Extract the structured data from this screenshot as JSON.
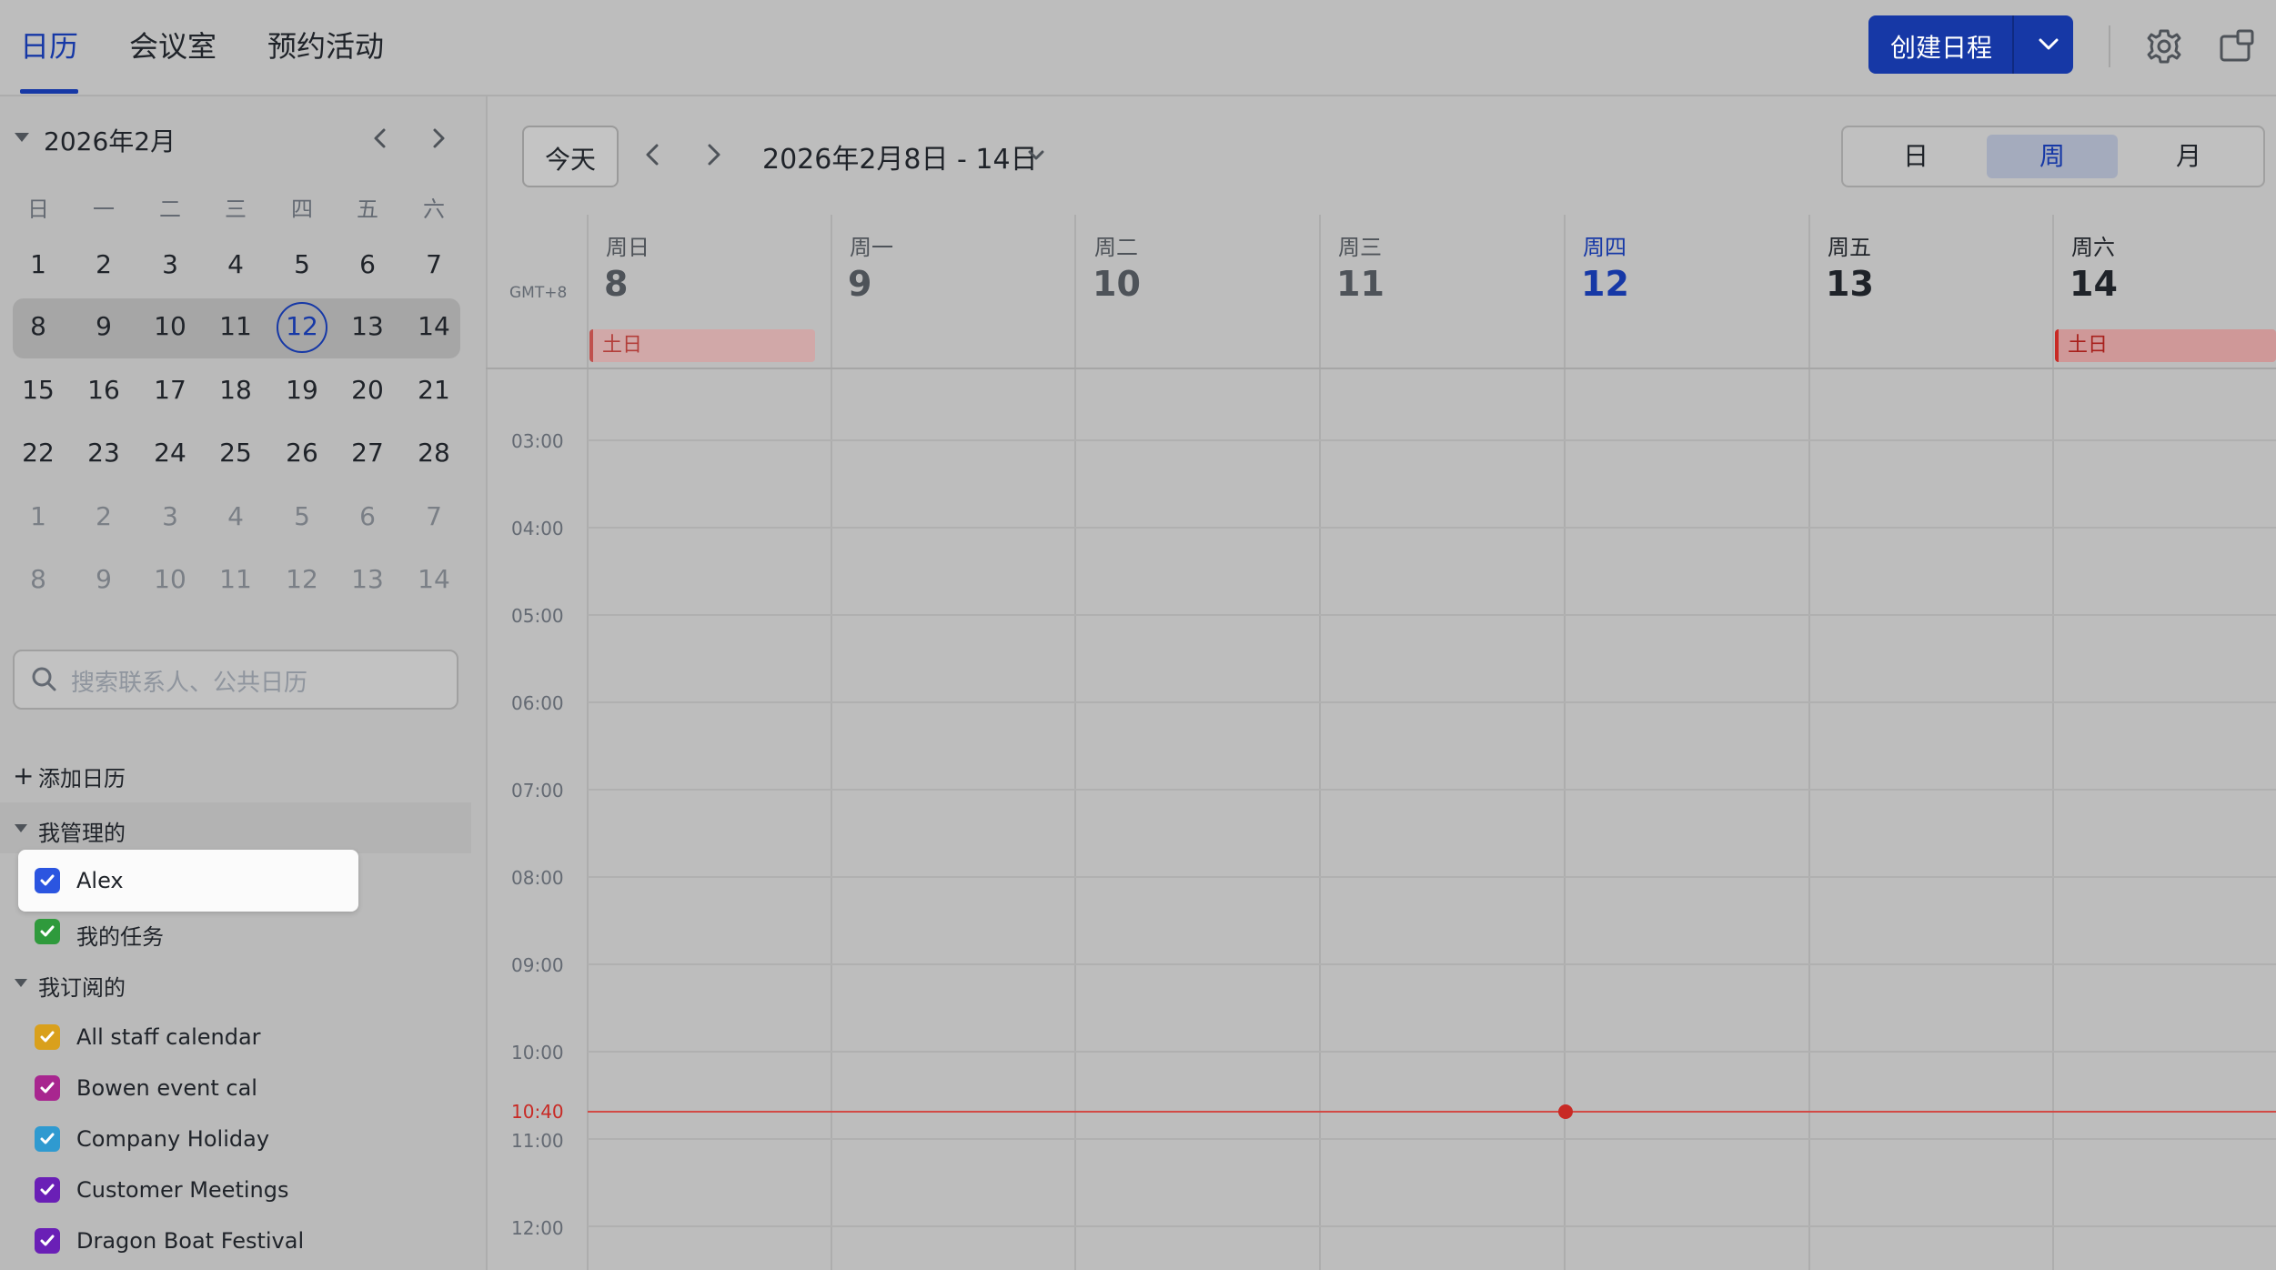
{
  "nav": {
    "tabs": [
      {
        "label": "日历",
        "active": true
      },
      {
        "label": "会议室"
      },
      {
        "label": "预约活动"
      }
    ],
    "create_label": "创建日程",
    "accent": "#1638a6"
  },
  "mini_calendar": {
    "month_label": "2026年2月",
    "weekdays": [
      "日",
      "一",
      "二",
      "三",
      "四",
      "五",
      "六"
    ],
    "weeks": [
      [
        "1",
        "2",
        "3",
        "4",
        "5",
        "6",
        "7"
      ],
      [
        "8",
        "9",
        "10",
        "11",
        "12",
        "13",
        "14"
      ],
      [
        "15",
        "16",
        "17",
        "18",
        "19",
        "20",
        "21"
      ],
      [
        "22",
        "23",
        "24",
        "25",
        "26",
        "27",
        "28"
      ],
      [
        "1",
        "2",
        "3",
        "4",
        "5",
        "6",
        "7"
      ],
      [
        "8",
        "9",
        "10",
        "11",
        "12",
        "13",
        "14"
      ]
    ],
    "today": "12"
  },
  "search": {
    "placeholder": "搜索联系人、公共日历"
  },
  "sidebar": {
    "add_calendar": "添加日历",
    "managed_title": "我管理的",
    "managed": [
      {
        "label": "Alex",
        "color": "#2b55e0"
      },
      {
        "label": "我的任务",
        "color": "#2f9a3c"
      }
    ],
    "subscribed_title": "我订阅的",
    "subscribed": [
      {
        "label": "All staff calendar",
        "color": "#d9a01c"
      },
      {
        "label": "Bowen event cal",
        "color": "#a8268f"
      },
      {
        "label": "Company Holiday",
        "color": "#2f9ad0"
      },
      {
        "label": "Customer Meetings",
        "color": "#6a1fb6"
      },
      {
        "label": "Dragon Boat Festival",
        "color": "#6a1fb6"
      }
    ]
  },
  "toolbar": {
    "today": "今天",
    "range": "2026年2月8日 - 14日",
    "views": [
      "日",
      "周",
      "月"
    ],
    "active_view": "周"
  },
  "week": {
    "timezone": "GMT+8",
    "days": [
      {
        "name": "周日",
        "date": "8"
      },
      {
        "name": "周一",
        "date": "9"
      },
      {
        "name": "周二",
        "date": "10"
      },
      {
        "name": "周三",
        "date": "11"
      },
      {
        "name": "周四",
        "date": "12",
        "today": true
      },
      {
        "name": "周五",
        "date": "13"
      },
      {
        "name": "周六",
        "date": "14"
      }
    ],
    "all_day_events": [
      {
        "day": "周日",
        "label": "土日"
      },
      {
        "day": "周六",
        "label": "土日"
      }
    ],
    "hours": [
      "03:00",
      "04:00",
      "05:00",
      "06:00",
      "07:00",
      "08:00",
      "09:00",
      "10:00",
      "11:00",
      "12:00"
    ],
    "now": "10:40"
  }
}
